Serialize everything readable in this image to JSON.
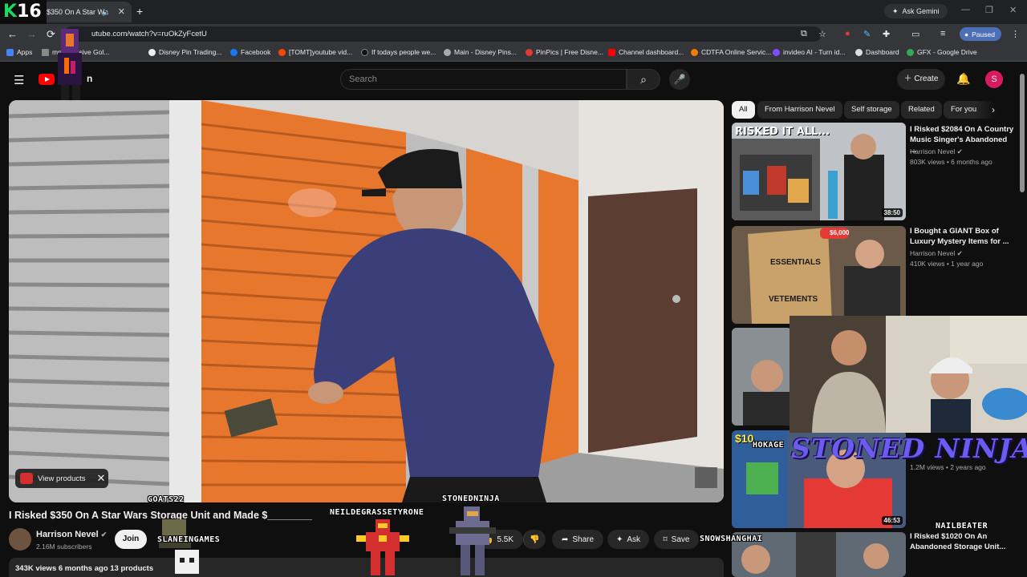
{
  "browser": {
    "tab_title": "$350 On A Star Wa",
    "new_tab": "+",
    "ask_gemini": "Ask Gemini",
    "url": "utube.com/watch?v=ruOkZyFcetU",
    "profile_status": "Paused",
    "bookmarks": [
      {
        "label": "Apps",
        "color": "#4285f4"
      },
      {
        "label": "mprehensive Gol...",
        "color": "#888888"
      },
      {
        "label": "Disney Pin Trading...",
        "color": "#eeeeee"
      },
      {
        "label": "Facebook",
        "color": "#1877f2"
      },
      {
        "label": "[TOMT]youtube vid...",
        "color": "#ff4500"
      },
      {
        "label": "If todays people we...",
        "color": "#000000"
      },
      {
        "label": "Main - Disney Pins...",
        "color": "#aaaaaa"
      },
      {
        "label": "PinPics | Free Disne...",
        "color": "#e53935"
      },
      {
        "label": "Channel dashboard...",
        "color": "#ff0000"
      },
      {
        "label": "CDTFA Online Servic...",
        "color": "#f57c00"
      },
      {
        "label": "invideo AI - Turn id...",
        "color": "#7c4dff"
      },
      {
        "label": "Dashboard",
        "color": "#dddddd"
      },
      {
        "label": "GFX - Google Drive",
        "color": "#34a853"
      }
    ]
  },
  "overlay": {
    "logo_k": "K",
    "logo_num": "16",
    "names": [
      "GOATS22",
      "STONEDNINJA",
      "NEILDEGRASSETYRONE",
      "SLANEINGAMES",
      "SNOWSHANGHAI",
      "NAILBEATER",
      "HOKAGE",
      "STONED NINJA"
    ]
  },
  "masthead": {
    "search_placeholder": "Search",
    "create_label": "Create",
    "avatar_letter": "S",
    "logo_text": "n"
  },
  "video": {
    "view_products": "View products",
    "title": "I Risked $350 On A Star Wars Storage Unit and Made $________",
    "channel": "Harrison Nevel",
    "subscribers": "2.16M subscribers",
    "join": "Join",
    "likes": "5.5K",
    "share": "Share",
    "ask": "Ask",
    "save": "Save",
    "description": "343K views  6 months ago  13 products"
  },
  "chips": [
    "All",
    "From Harrison Nevel",
    "Self storage",
    "Related",
    "For you"
  ],
  "related": [
    {
      "title": "I Risked $2084 On A Country Music Singer's Abandoned ...",
      "channel": "Harrison Nevel",
      "meta": "803K views • 6 months ago",
      "duration": "38:50",
      "thumb_text": "RISKED IT ALL..."
    },
    {
      "title": "I Bought a GIANT Box of Luxury Mystery Items for ...",
      "channel": "Harrison Nevel",
      "meta": "410K views • 1 year ago",
      "duration": "",
      "thumb_text": "$6,000"
    },
    {
      "title": "",
      "channel": "",
      "meta": "",
      "duration": "",
      "thumb_text": ""
    },
    {
      "title": "",
      "channel": "",
      "meta": "1.2M views • 2 years ago",
      "duration": "46:53",
      "thumb_text": "$10"
    },
    {
      "title": "I Risked $1020 On An Abandoned Storage Unit...",
      "channel": "",
      "meta": "",
      "duration": "",
      "thumb_text": ""
    }
  ],
  "thumb_labels": {
    "essentials": "ESSENTIALS",
    "vetements": "VETEMENTS"
  },
  "colors": {
    "accent": "#ff0000",
    "storage_door": "#e8772e",
    "paused": "#4d6fb8"
  }
}
